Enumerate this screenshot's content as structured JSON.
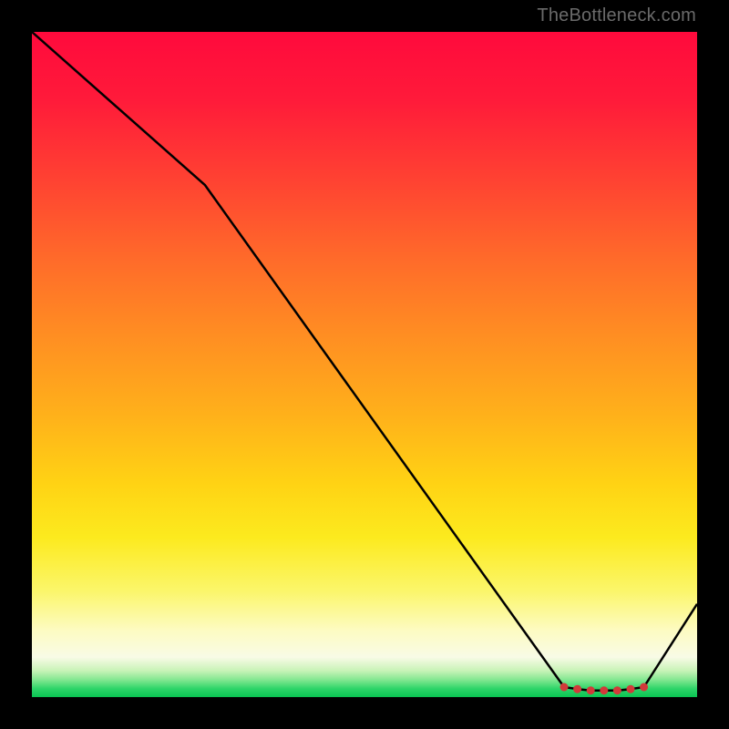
{
  "watermark": "TheBottleneck.com",
  "chart_data": {
    "type": "line",
    "title": "",
    "xlabel": "",
    "ylabel": "",
    "xlim": [
      0,
      100
    ],
    "ylim": [
      0,
      100
    ],
    "series": [
      {
        "name": "curve",
        "x": [
          0,
          26,
          80,
          82,
          84,
          86,
          88,
          90,
          92,
          100
        ],
        "values": [
          100,
          77,
          1.5,
          1.2,
          1.0,
          1.0,
          1.0,
          1.2,
          1.5,
          14
        ]
      }
    ],
    "markers": {
      "name": "flat-segment-dots",
      "x": [
        80,
        82,
        84,
        86,
        88,
        90,
        92
      ],
      "values": [
        1.5,
        1.2,
        1.0,
        1.0,
        1.0,
        1.2,
        1.5
      ],
      "color": "#d23a3a"
    },
    "background_gradient": {
      "stops": [
        {
          "pos": 0.0,
          "color": "#ff0a3c"
        },
        {
          "pos": 0.46,
          "color": "#ff8f22"
        },
        {
          "pos": 0.76,
          "color": "#fcea1e"
        },
        {
          "pos": 0.94,
          "color": "#f8fbe6"
        },
        {
          "pos": 1.0,
          "color": "#09c552"
        }
      ]
    }
  }
}
